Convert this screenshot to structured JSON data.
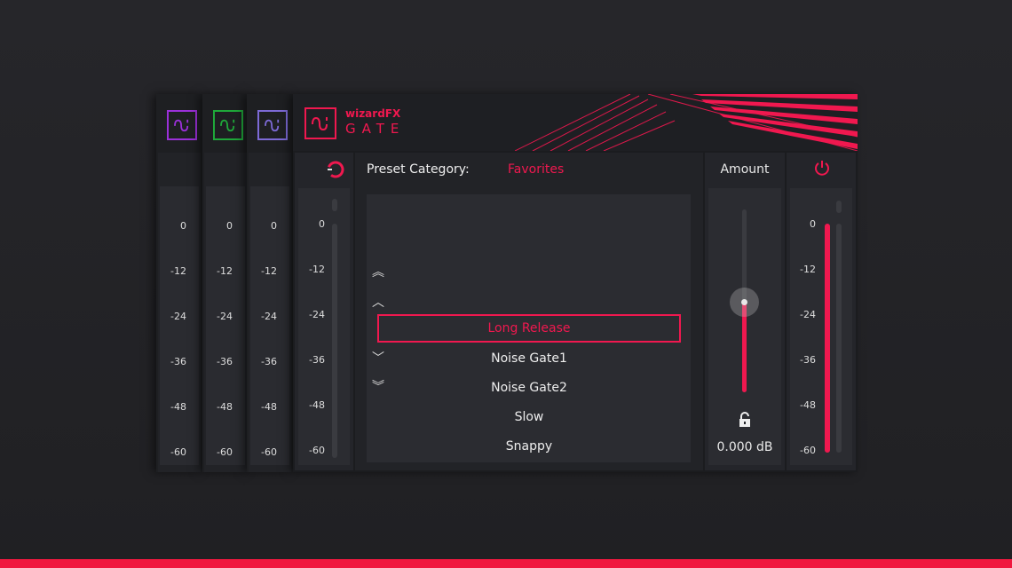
{
  "plugins": [
    {
      "color": "#9b30d9"
    },
    {
      "color": "#1fa83a"
    },
    {
      "color": "#7d6ad6"
    }
  ],
  "main": {
    "brand": "wizardFX",
    "product": "GATE",
    "accent": "#f0184f",
    "meter_labels": [
      "0",
      "-12",
      "-24",
      "-36",
      "-48",
      "-60"
    ],
    "preset_category_label": "Preset Category:",
    "preset_category_value": "Favorites",
    "presets": [
      "Long Release",
      "Noise Gate1",
      "Noise Gate2",
      "Slow",
      "Snappy"
    ],
    "selected_preset": "Long Release",
    "amount_label": "Amount",
    "amount_value": "0.000 dB",
    "amount_fraction": 0.5,
    "output_level_fraction": 0.99,
    "icons": [
      "power-icon",
      "lock-open-icon",
      "double-chevron-up-icon",
      "chevron-up-icon",
      "chevron-down-icon",
      "double-chevron-down-icon",
      "wave-logo-icon"
    ]
  }
}
